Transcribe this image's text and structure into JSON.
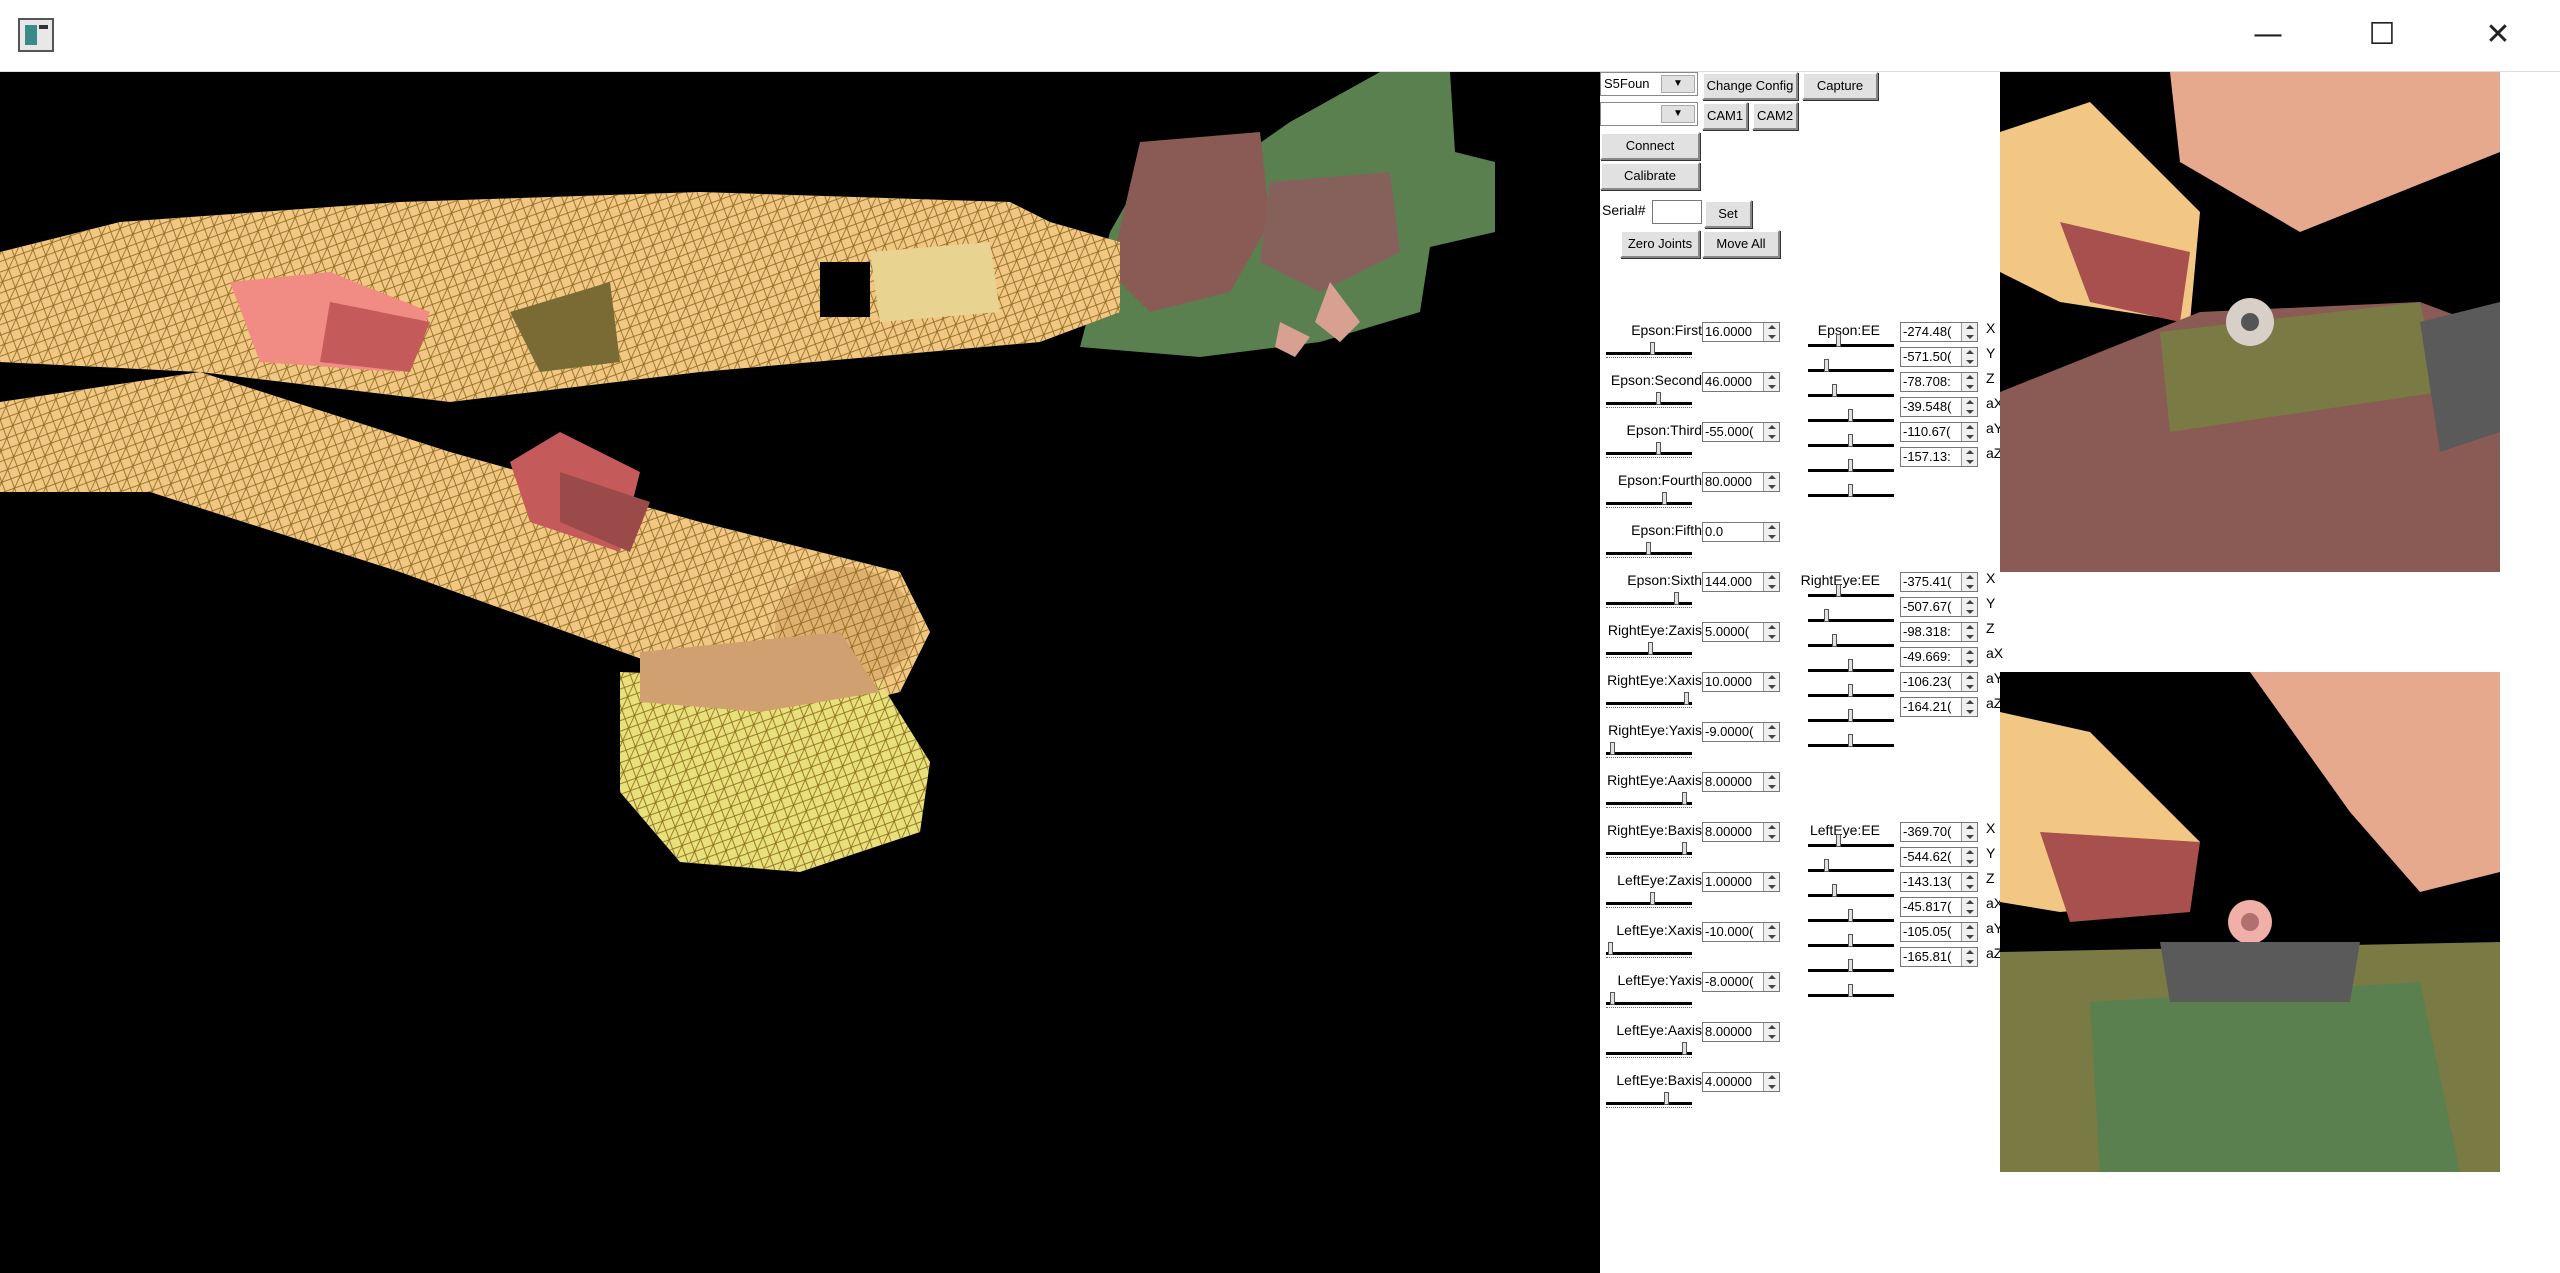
{
  "window": {
    "icon": "app-window-icon",
    "minimize": "—",
    "maximize": "☐",
    "close": "✕"
  },
  "toolbar": {
    "config_select": "S5Foun",
    "camera_select": "",
    "change_config": "Change Config",
    "capture": "Capture",
    "cam1": "CAM1",
    "cam2": "CAM2",
    "connect": "Connect",
    "calibrate": "Calibrate",
    "serial_label": "Serial#",
    "serial_value": "",
    "set": "Set",
    "zero_joints": "Zero Joints",
    "move_all": "Move All"
  },
  "joints": [
    {
      "label": "Epson:First",
      "value": "16.0000",
      "level": 0.55
    },
    {
      "label": "Epson:Second",
      "value": "46.0000",
      "level": 0.62
    },
    {
      "label": "Epson:Third",
      "value": "-55.000(",
      "level": 0.62
    },
    {
      "label": "Epson:Fourth",
      "value": "80.0000",
      "level": 0.7
    },
    {
      "label": "Epson:Fifth",
      "value": "0.0",
      "level": 0.5
    },
    {
      "label": "Epson:Sixth",
      "value": "144.000",
      "level": 0.85
    },
    {
      "label": "RightEye:Zaxis",
      "value": "5.0000(",
      "level": 0.52
    },
    {
      "label": "RightEye:Xaxis",
      "value": "10.0000",
      "level": 0.97
    },
    {
      "label": "RightEye:Yaxis",
      "value": "-9.0000(",
      "level": 0.05
    },
    {
      "label": "RightEye:Aaxis",
      "value": "8.00000",
      "level": 0.95
    },
    {
      "label": "RightEye:Baxis",
      "value": "8.00000",
      "level": 0.95
    },
    {
      "label": "LeftEye:Zaxis",
      "value": "1.00000",
      "level": 0.55
    },
    {
      "label": "LeftEye:Xaxis",
      "value": "-10.000(",
      "level": 0.03
    },
    {
      "label": "LeftEye:Yaxis",
      "value": "-8.0000(",
      "level": 0.05
    },
    {
      "label": "LeftEye:Aaxis",
      "value": "8.00000",
      "level": 0.95
    },
    {
      "label": "LeftEye:Baxis",
      "value": "4.00000",
      "level": 0.72
    }
  ],
  "ee_groups": [
    {
      "label": "Epson:EE",
      "values": [
        "-274.48(",
        "-571.50(",
        "-78.708:",
        "-39.548(",
        "-110.67(",
        "-157.13:"
      ],
      "levels": [
        0.35,
        0.2,
        0.3,
        0.5,
        0.5,
        0.5,
        0.5
      ]
    },
    {
      "label": "RightEye:EE",
      "values": [
        "-375.41(",
        "-507.67(",
        "-98.318:",
        "-49.669:",
        "-106.23(",
        "-164.21("
      ],
      "levels": [
        0.35,
        0.2,
        0.3,
        0.5,
        0.5,
        0.5,
        0.5
      ]
    },
    {
      "label": "LeftEye:EE",
      "values": [
        "-369.70(",
        "-544.62(",
        "-143.13(",
        "-45.817(",
        "-105.05(",
        "-165.81("
      ],
      "levels": [
        0.35,
        0.2,
        0.3,
        0.5,
        0.5,
        0.5,
        0.5
      ]
    }
  ],
  "axis_labels": [
    "X",
    "Y",
    "Z",
    "aX",
    "aY",
    "aZ"
  ]
}
